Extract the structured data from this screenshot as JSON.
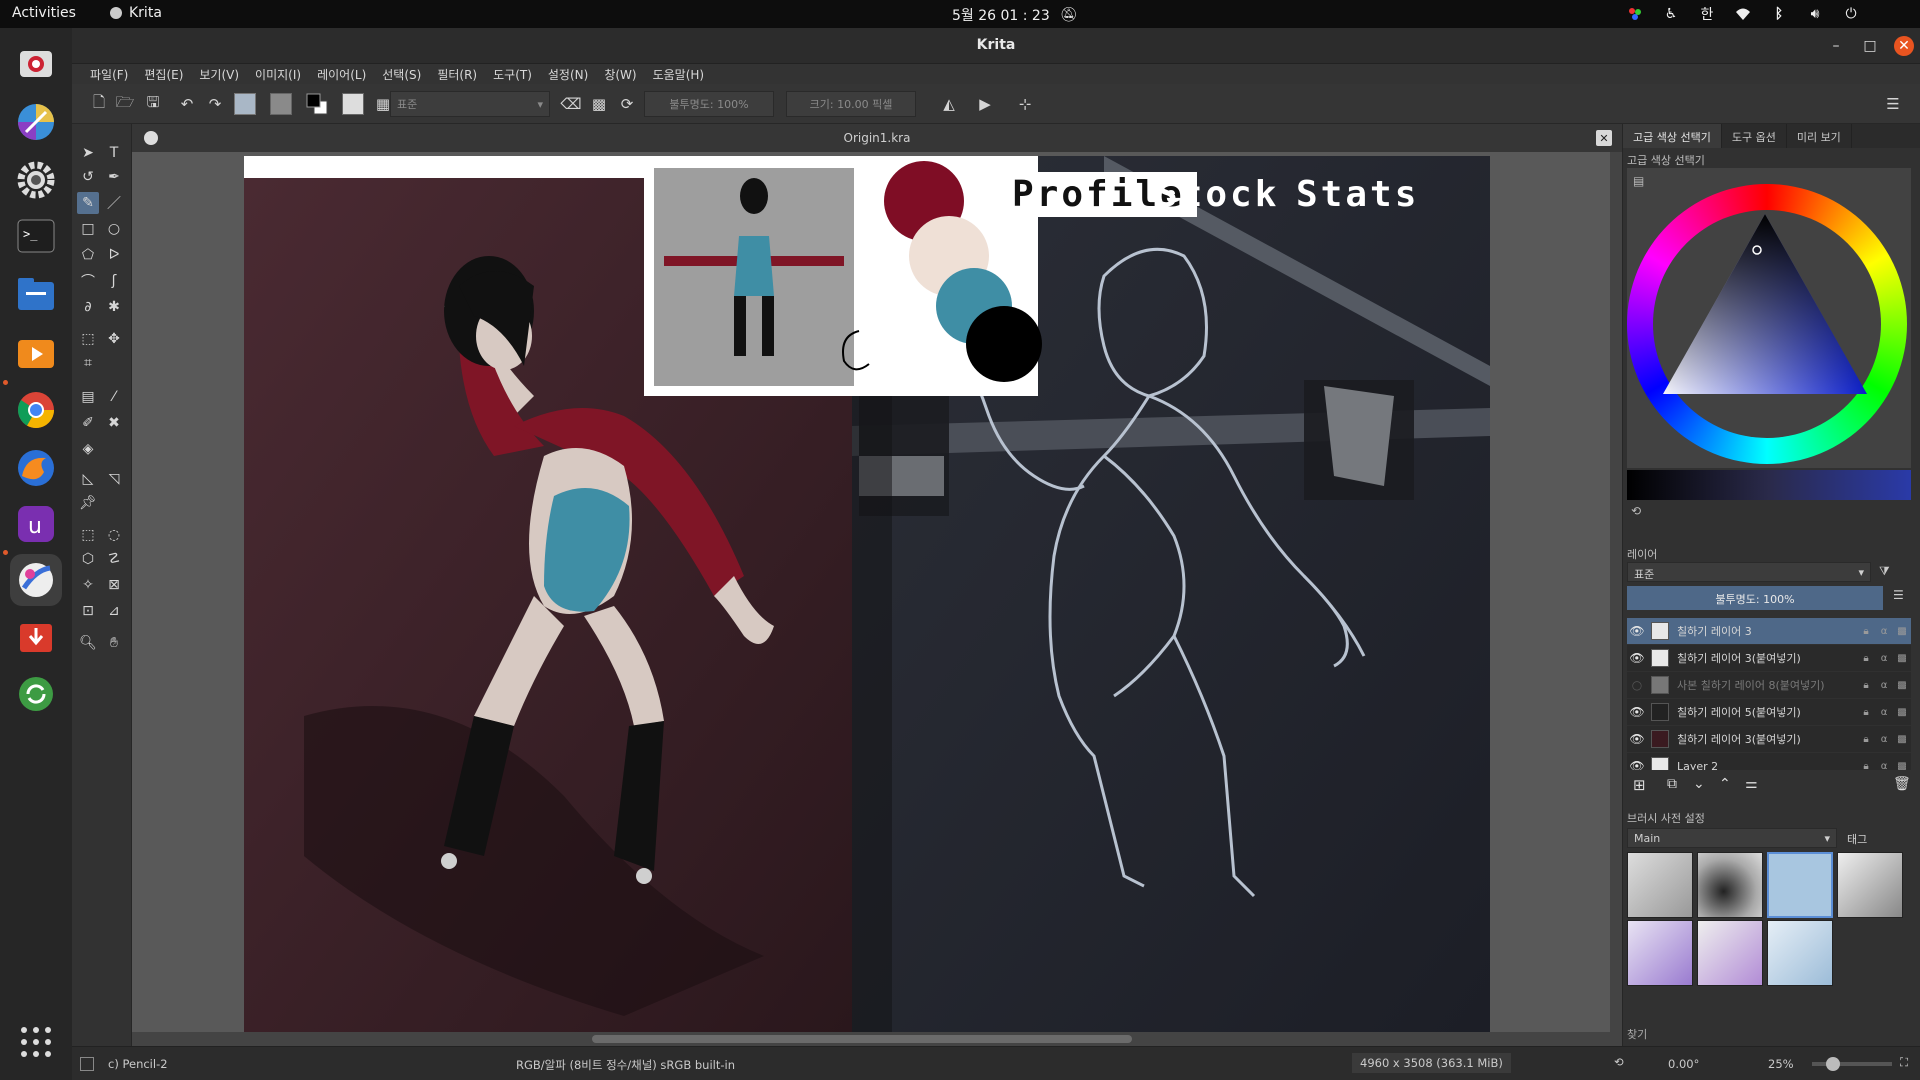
{
  "system": {
    "activities": "Activities",
    "app_name": "Krita",
    "clock": "5월 26  01 : 23",
    "ime": "한"
  },
  "dock": {
    "apps": [
      {
        "name": "screenshot-app-icon"
      },
      {
        "name": "krita-alt-icon"
      },
      {
        "name": "settings-icon"
      },
      {
        "name": "terminal-icon"
      },
      {
        "name": "files-icon"
      },
      {
        "name": "media-player-icon"
      },
      {
        "name": "chrome-icon"
      },
      {
        "name": "firefox-icon"
      },
      {
        "name": "unity-hub-icon"
      },
      {
        "name": "krita-icon"
      },
      {
        "name": "video-downloader-icon"
      },
      {
        "name": "update-icon"
      },
      {
        "name": "show-apps-icon"
      }
    ]
  },
  "window": {
    "title": "Krita",
    "minimize": "–",
    "maximize": "□",
    "close": "✕"
  },
  "menu": [
    "파일(F)",
    "편집(E)",
    "보기(V)",
    "이미지(I)",
    "레이어(L)",
    "선택(S)",
    "필터(R)",
    "도구(T)",
    "설정(N)",
    "창(W)",
    "도움말(H)"
  ],
  "toolbar": {
    "blend_mode": "표준",
    "opacity": "불투명도: 100%",
    "size": "크기: 10.00 픽셀"
  },
  "document": {
    "tab_name": "Origin1.kra",
    "tabs": [
      "Profile",
      "Stock",
      "Stats"
    ]
  },
  "dockers": {
    "top_tabs": [
      "고급 색상 선택기",
      "도구 옵션",
      "미리 보기"
    ],
    "color_selector_title": "고급 색상 선택기",
    "layers_title": "레이어",
    "blend_mode": "표준",
    "layer_opacity": "불투명도: 100%",
    "layers": [
      {
        "name": "칠하기 레이어 3",
        "visible": true,
        "selected": true
      },
      {
        "name": "칠하기 레이어 3(붙여넣기)",
        "visible": true,
        "selected": false
      },
      {
        "name": "사본 칠하기 레이어 8(붙여넣기)",
        "visible": false,
        "selected": false
      },
      {
        "name": "칠하기 레이어 5(붙여넣기)",
        "visible": true,
        "selected": false
      },
      {
        "name": "칠하기 레이어 3(붙여넣기)",
        "visible": true,
        "selected": false
      },
      {
        "name": "Layer 2",
        "visible": true,
        "selected": false
      }
    ],
    "brush_presets_title": "브러시 사전 설정",
    "preset_group": "Main",
    "tag_label": "태그",
    "search_label": "찾기"
  },
  "status": {
    "brush": "c) Pencil-2",
    "color_space": "RGB/알파 (8비트 정수/채널)  sRGB built-in",
    "doc_size": "4960 x 3508 (363.1 MiB)",
    "rotation": "0.00°",
    "zoom": "25%"
  },
  "colors": {
    "accent": "#e95420",
    "selection": "#4e6888",
    "palette": [
      "#7f0d25",
      "#efe0d6",
      "#3f8ea5",
      "#000000"
    ]
  }
}
